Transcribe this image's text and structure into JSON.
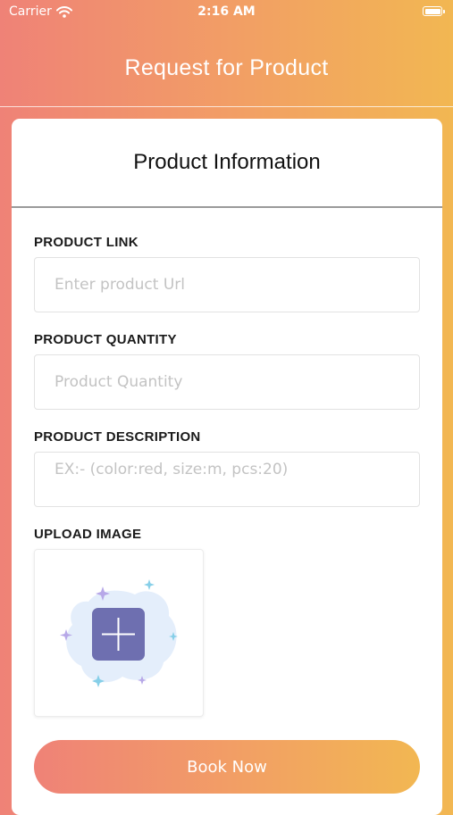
{
  "status_bar": {
    "carrier": "Carrier",
    "time": "2:16 AM"
  },
  "nav": {
    "title": "Request for Product"
  },
  "card": {
    "title": "Product Information"
  },
  "fields": {
    "link": {
      "label": "PRODUCT LINK",
      "placeholder": "Enter product Url",
      "value": ""
    },
    "quantity": {
      "label": "PRODUCT QUANTITY",
      "placeholder": "Product Quantity",
      "value": ""
    },
    "description": {
      "label": "PRODUCT DESCRIPTION",
      "placeholder": "EX:- (color:red, size:m, pcs:20)",
      "value": ""
    }
  },
  "upload": {
    "label": "UPLOAD IMAGE",
    "icon": "add-image-icon"
  },
  "button": {
    "label": "Book Now"
  },
  "colors": {
    "gradient_start": "#EF8277",
    "gradient_end": "#F2B752",
    "upload_tile": "#6E6FB0"
  }
}
